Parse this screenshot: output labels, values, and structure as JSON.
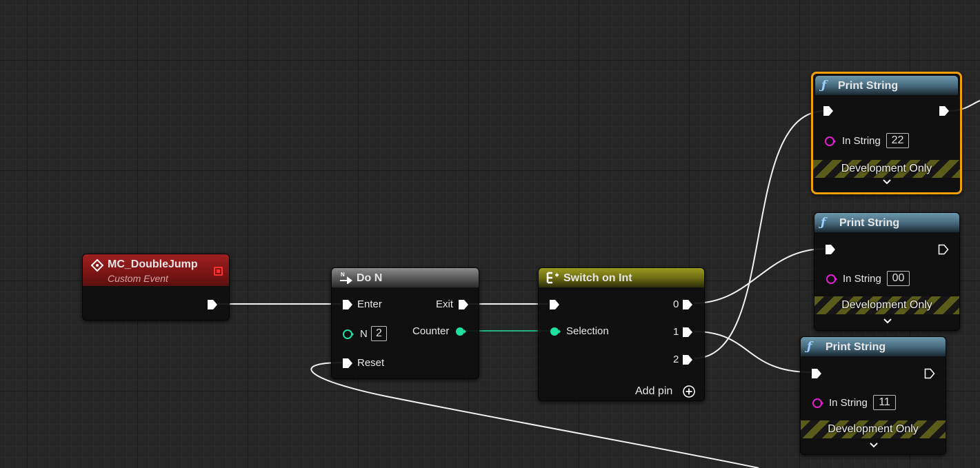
{
  "colors": {
    "background": "#262626",
    "event_header": "#8e1b1b",
    "flow_header": "#707070",
    "switch_header": "#7a7a18",
    "function_header": "#4f7384",
    "selection_border": "#f2a007",
    "exec_wire": "#ffffff",
    "int_pin": "#1ee0a0",
    "string_pin": "#e020d0"
  },
  "nodes": {
    "event": {
      "title": "MC_DoubleJump",
      "subtitle": "Custom Event",
      "icon": "event-diamond-icon"
    },
    "do_n": {
      "title": "Do N",
      "icon": "do-n-icon",
      "enter_label": "Enter",
      "n_label": "N",
      "n_value": "2",
      "reset_label": "Reset",
      "exit_label": "Exit",
      "counter_label": "Counter"
    },
    "switch": {
      "title": "Switch on Int",
      "icon": "switch-icon",
      "selection_label": "Selection",
      "out_pins": [
        "0",
        "1",
        "2"
      ],
      "add_pin_label": "Add pin"
    },
    "print_strings": [
      {
        "title": "Print String",
        "in_string_label": "In String",
        "value": "22",
        "dev_label": "Development Only"
      },
      {
        "title": "Print String",
        "in_string_label": "In String",
        "value": "00",
        "dev_label": "Development Only"
      },
      {
        "title": "Print String",
        "in_string_label": "In String",
        "value": "11",
        "dev_label": "Development Only"
      }
    ]
  }
}
